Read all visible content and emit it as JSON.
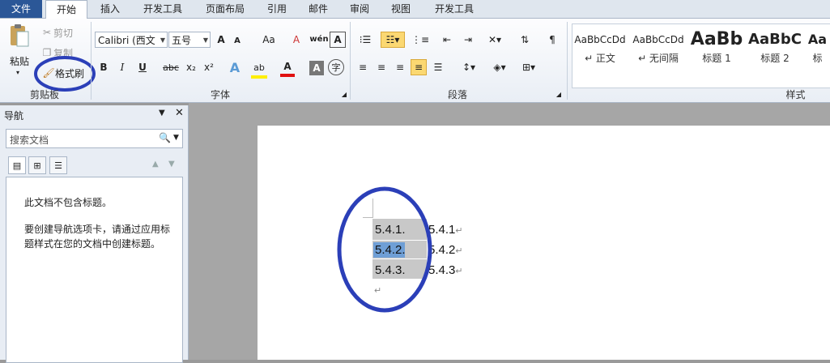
{
  "tabs": [
    "文件",
    "开始",
    "插入",
    "开发工具",
    "页面布局",
    "引用",
    "邮件",
    "审阅",
    "视图",
    "开发工具"
  ],
  "clipboard": {
    "paste": "粘贴",
    "cut": "剪切",
    "copy": "复制",
    "format_painter": "格式刷",
    "group_label": "剪贴板"
  },
  "font": {
    "name": "Calibri (西文",
    "size": "五号",
    "group_label": "字体",
    "bold": "B",
    "italic": "I",
    "underline": "U",
    "strike": "abc",
    "subscript": "x₂",
    "superscript": "x²",
    "grow": "A",
    "shrink": "A",
    "case": "Aa",
    "clear": "A",
    "phonetic": "wén",
    "border": "A",
    "effects": "A",
    "highlight": "ab",
    "color": "A",
    "shading": "A",
    "enclose": "字"
  },
  "paragraph": {
    "group_label": "段落"
  },
  "styles": {
    "group_label": "样式",
    "items": [
      {
        "sample": "AaBbCcDd",
        "name": "↵ 正文"
      },
      {
        "sample": "AaBbCcDd",
        "name": "↵ 无间隔"
      },
      {
        "sample": "AaBb",
        "name": "标题 1"
      },
      {
        "sample": "AaBbC",
        "name": "标题 2"
      },
      {
        "sample": "Aa",
        "name": "标"
      }
    ]
  },
  "nav": {
    "title": "导航",
    "search_placeholder": "搜索文档",
    "message1": "此文档不包含标题。",
    "message2": "要创建导航选项卡，请通过应用标题样式在您的文档中创建标题。"
  },
  "document": {
    "rows": [
      {
        "number": "5.4.1.",
        "text": "5.4.1"
      },
      {
        "number": "5.4.2.",
        "text": "5.4.2"
      },
      {
        "number": "5.4.3.",
        "text": "5.4.3"
      }
    ],
    "para_mark": "↵"
  },
  "colors": {
    "annotation": "#2b3fb8",
    "file_tab": "#2b5797",
    "selection": "#6f9fd6"
  }
}
